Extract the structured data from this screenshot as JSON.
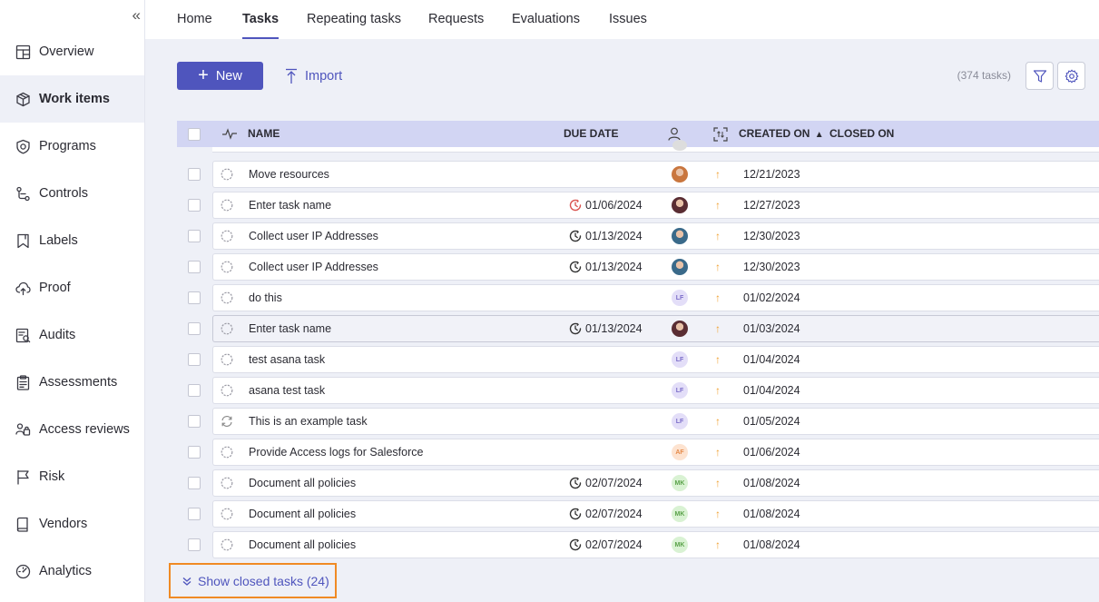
{
  "sidebar": {
    "collapse_glyph": "«",
    "items": [
      {
        "label": "Overview",
        "icon": "overview-icon"
      },
      {
        "label": "Work items",
        "icon": "box-icon",
        "active": true
      },
      {
        "label": "Programs",
        "icon": "shield-icon"
      },
      {
        "label": "Controls",
        "icon": "controls-icon"
      },
      {
        "label": "Labels",
        "icon": "bookmark-icon"
      },
      {
        "label": "Proof",
        "icon": "cloud-upload-icon"
      },
      {
        "label": "Audits",
        "icon": "audit-icon"
      },
      {
        "label": "Assessments",
        "icon": "clipboard-icon"
      },
      {
        "label": "Access reviews",
        "icon": "access-review-icon"
      },
      {
        "label": "Risk",
        "icon": "flag-icon"
      },
      {
        "label": "Vendors",
        "icon": "vendor-icon"
      },
      {
        "label": "Analytics",
        "icon": "gauge-icon"
      }
    ]
  },
  "tabs": [
    {
      "label": "Home"
    },
    {
      "label": "Tasks",
      "active": true
    },
    {
      "label": "Repeating tasks"
    },
    {
      "label": "Requests"
    },
    {
      "label": "Evaluations"
    },
    {
      "label": "Issues"
    }
  ],
  "toolbar": {
    "new_label": "New",
    "import_label": "Import",
    "task_count": "(374 tasks)"
  },
  "table": {
    "headers": {
      "name": "NAME",
      "due_date": "DUE DATE",
      "created_on": "CREATED ON",
      "closed_on": "CLOSED ON"
    },
    "sort_indicator": "▲",
    "rows": [
      {
        "name": "Move resources",
        "due": "",
        "due_overdue": false,
        "avatar": {
          "type": "photo",
          "color": "#c9763e"
        },
        "created": "12/21/2023",
        "status": "open"
      },
      {
        "name": "Enter task name",
        "due": "01/06/2024",
        "due_overdue": true,
        "avatar": {
          "type": "photo",
          "color": "#5a2d33"
        },
        "created": "12/27/2023",
        "status": "open"
      },
      {
        "name": "Collect user IP Addresses",
        "due": "01/13/2024",
        "due_overdue": false,
        "avatar": {
          "type": "photo",
          "color": "#3a6a8a"
        },
        "created": "12/30/2023",
        "status": "open"
      },
      {
        "name": "Collect user IP Addresses",
        "due": "01/13/2024",
        "due_overdue": false,
        "avatar": {
          "type": "photo",
          "color": "#3a6a8a"
        },
        "created": "12/30/2023",
        "status": "open"
      },
      {
        "name": "do this",
        "due": "",
        "due_overdue": false,
        "avatar": {
          "type": "initials",
          "text": "LF",
          "bg": "#e3def8",
          "fg": "#7b6cc9"
        },
        "created": "01/02/2024",
        "status": "open"
      },
      {
        "name": "Enter task name",
        "due": "01/13/2024",
        "due_overdue": false,
        "avatar": {
          "type": "photo",
          "color": "#5a2d33"
        },
        "created": "01/03/2024",
        "status": "open",
        "hovered": true
      },
      {
        "name": "test asana task",
        "due": "",
        "due_overdue": false,
        "avatar": {
          "type": "initials",
          "text": "LF",
          "bg": "#e3def8",
          "fg": "#7b6cc9"
        },
        "created": "01/04/2024",
        "status": "open"
      },
      {
        "name": "asana test task",
        "due": "",
        "due_overdue": false,
        "avatar": {
          "type": "initials",
          "text": "LF",
          "bg": "#e3def8",
          "fg": "#7b6cc9"
        },
        "created": "01/04/2024",
        "status": "open"
      },
      {
        "name": "This is an example task",
        "due": "",
        "due_overdue": false,
        "avatar": {
          "type": "initials",
          "text": "LF",
          "bg": "#e3def8",
          "fg": "#7b6cc9"
        },
        "created": "01/05/2024",
        "status": "repeating"
      },
      {
        "name": "Provide Access logs for Salesforce",
        "due": "",
        "due_overdue": false,
        "avatar": {
          "type": "initials",
          "text": "AF",
          "bg": "#fde3d0",
          "fg": "#e58a4a"
        },
        "created": "01/06/2024",
        "status": "open"
      },
      {
        "name": "Document all policies",
        "due": "02/07/2024",
        "due_overdue": false,
        "avatar": {
          "type": "initials",
          "text": "MK",
          "bg": "#d9f2d3",
          "fg": "#5aa24a"
        },
        "created": "01/08/2024",
        "status": "open"
      },
      {
        "name": "Document all policies",
        "due": "02/07/2024",
        "due_overdue": false,
        "avatar": {
          "type": "initials",
          "text": "MK",
          "bg": "#d9f2d3",
          "fg": "#5aa24a"
        },
        "created": "01/08/2024",
        "status": "open"
      },
      {
        "name": "Document all policies",
        "due": "02/07/2024",
        "due_overdue": false,
        "avatar": {
          "type": "initials",
          "text": "MK",
          "bg": "#d9f2d3",
          "fg": "#5aa24a"
        },
        "created": "01/08/2024",
        "status": "open"
      }
    ],
    "priority_glyph": "↑"
  },
  "show_closed_label": "Show closed tasks (24)",
  "colors": {
    "accent": "#4f55bd",
    "highlight_border": "#f08a24",
    "priority": "#f0a030",
    "overdue": "#d9534f"
  }
}
